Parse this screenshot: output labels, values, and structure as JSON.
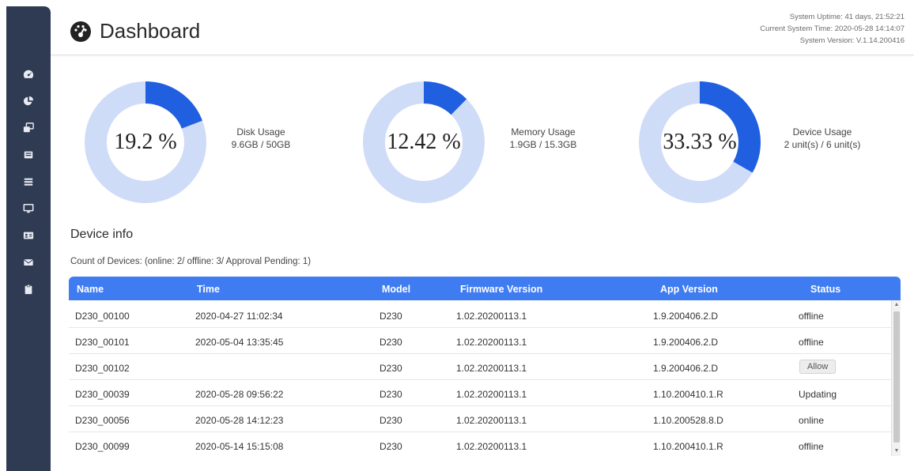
{
  "header": {
    "title": "Dashboard",
    "uptime": "System Uptime: 41 days, 21:52:21",
    "current_time": "Current System Time: 2020-05-28 14:14:07",
    "version": "System Version: V.1.14.200416"
  },
  "sidebar": {
    "items": [
      {
        "icon": "dashboard-icon"
      },
      {
        "icon": "pie-chart-icon"
      },
      {
        "icon": "devices-icon"
      },
      {
        "icon": "screen-icon"
      },
      {
        "icon": "list-icon"
      },
      {
        "icon": "monitor-icon"
      },
      {
        "icon": "id-card-icon"
      },
      {
        "icon": "mail-icon"
      },
      {
        "icon": "clipboard-icon"
      }
    ]
  },
  "colors": {
    "accent": "#1f5fe0",
    "ring_bg": "#cfdcf8",
    "table_header": "#3f7cf2",
    "sidebar": "#2f3b52"
  },
  "gauges": [
    {
      "value_text": "19.2 %",
      "fraction": 0.192,
      "label": "Disk Usage",
      "detail": "9.6GB / 50GB"
    },
    {
      "value_text": "12.42 %",
      "fraction": 0.1242,
      "label": "Memory Usage",
      "detail": "1.9GB / 15.3GB"
    },
    {
      "value_text": "33.33 %",
      "fraction": 0.3333,
      "label": "Device Usage",
      "detail": "2 unit(s) / 6 unit(s)"
    }
  ],
  "device_info": {
    "title": "Device info",
    "count_line": "Count of Devices: (online: 2/ offline: 3/ Approval Pending: 1)",
    "columns": [
      "Name",
      "Time",
      "Model",
      "Firmware Version",
      "App Version",
      "Status"
    ],
    "rows": [
      {
        "name": "D230_00100",
        "time": "2020-04-27 11:02:34",
        "model": "D230",
        "firmware": "1.02.20200113.1",
        "app": "1.9.200406.2.D",
        "status": "offline"
      },
      {
        "name": "D230_00101",
        "time": "2020-05-04 13:35:45",
        "model": "D230",
        "firmware": "1.02.20200113.1",
        "app": "1.9.200406.2.D",
        "status": "offline"
      },
      {
        "name": "D230_00102",
        "time": "",
        "model": "D230",
        "firmware": "1.02.20200113.1",
        "app": "1.9.200406.2.D",
        "status": "Allow"
      },
      {
        "name": "D230_00039",
        "time": "2020-05-28 09:56:22",
        "model": "D230",
        "firmware": "1.02.20200113.1",
        "app": "1.10.200410.1.R",
        "status": "Updating"
      },
      {
        "name": "D230_00056",
        "time": "2020-05-28 14:12:23",
        "model": "D230",
        "firmware": "1.02.20200113.1",
        "app": "1.10.200528.8.D",
        "status": "online"
      },
      {
        "name": "D230_00099",
        "time": "2020-05-14 15:15:08",
        "model": "D230",
        "firmware": "1.02.20200113.1",
        "app": "1.10.200410.1.R",
        "status": "offline"
      }
    ]
  }
}
